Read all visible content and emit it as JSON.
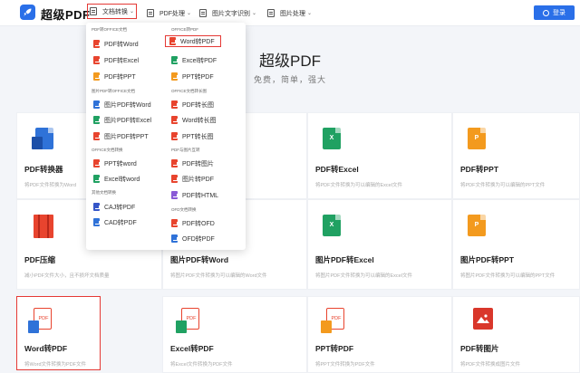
{
  "header": {
    "brand": "超级PDF",
    "nav": [
      {
        "label": "文档转换",
        "active": true
      },
      {
        "label": "PDF处理"
      },
      {
        "label": "图片文字识别"
      },
      {
        "label": "图片处理"
      }
    ],
    "login_label": "登录"
  },
  "hero": {
    "title": "超级PDF",
    "subtitle": "免费，简单，强大"
  },
  "dropdown": {
    "left_column": [
      {
        "category": "PDF转OFFICE文档",
        "items": [
          "PDF转Word",
          "PDF转Excel",
          "PDF转PPT"
        ]
      },
      {
        "category": "图片PDF转OFFICE文档",
        "items": [
          "图片PDF转Word",
          "图片PDF转Excel",
          "图片PDF转PPT"
        ]
      },
      {
        "category": "OFFICE文档转换",
        "items": [
          "PPT转word",
          "Excel转word"
        ]
      },
      {
        "category": "其他文档转换",
        "items": [
          "CAJ转PDF",
          "CAD转PDF"
        ]
      }
    ],
    "right_column": [
      {
        "category": "OFFICE转PDF",
        "items": [
          "Word转PDF",
          "Excel转PDF",
          "PPT转PDF"
        ]
      },
      {
        "category": "OFFICE文档转长图",
        "items": [
          "PDF转长图",
          "Word转长图",
          "PPT转长图"
        ]
      },
      {
        "category": "PDF与图片互转",
        "items": [
          "PDF转图片",
          "图片转PDF",
          "PDF转HTML"
        ]
      },
      {
        "category": "OFD文档转换",
        "items": [
          "PDF转OFD",
          "OFD转PDF"
        ]
      }
    ]
  },
  "cards": [
    {
      "title": "PDF转换器",
      "desc": "将PDF文件转换为Word"
    },
    {
      "title": "",
      "desc": ""
    },
    {
      "title": "PDF转Excel",
      "desc": "将PDF文件转换为可以编辑的Excel文件"
    },
    {
      "title": "PDF转PPT",
      "desc": "将PDF文件转换为可以编辑的PPT文件"
    },
    {
      "title": "PDF压缩",
      "desc": "减小PDF文件大小，且不损坏文档质量"
    },
    {
      "title": "图片PDF转Word",
      "desc": "将图片PDF文件转换为可以编辑的Word文件"
    },
    {
      "title": "图片PDF转Excel",
      "desc": "将图片PDF文件转换为可以编辑的Excel文件"
    },
    {
      "title": "图片PDF转PPT",
      "desc": "将图片PDF文件转换为可以编辑的PPT文件"
    },
    {
      "title": "Word转PDF",
      "desc": "将Word文件转换为PDF文件"
    },
    {
      "title": "Excel转PDF",
      "desc": "将Excel文件转换为PDF文件"
    },
    {
      "title": "PPT转PDF",
      "desc": "将PPT文件转换为PDF文件"
    },
    {
      "title": "PDF转图片",
      "desc": "将PDF文件转换成图片文件"
    }
  ],
  "icon_glyphs": {
    "excel": "X",
    "ppt": "P",
    "pdf": "PDF"
  },
  "colors": {
    "accent": "#2a6fe8",
    "highlight_border": "#e53935",
    "pdf_red": "#e8442e",
    "word_blue": "#2f72d8",
    "excel_green": "#20a162",
    "ppt_orange": "#f39a1e"
  }
}
